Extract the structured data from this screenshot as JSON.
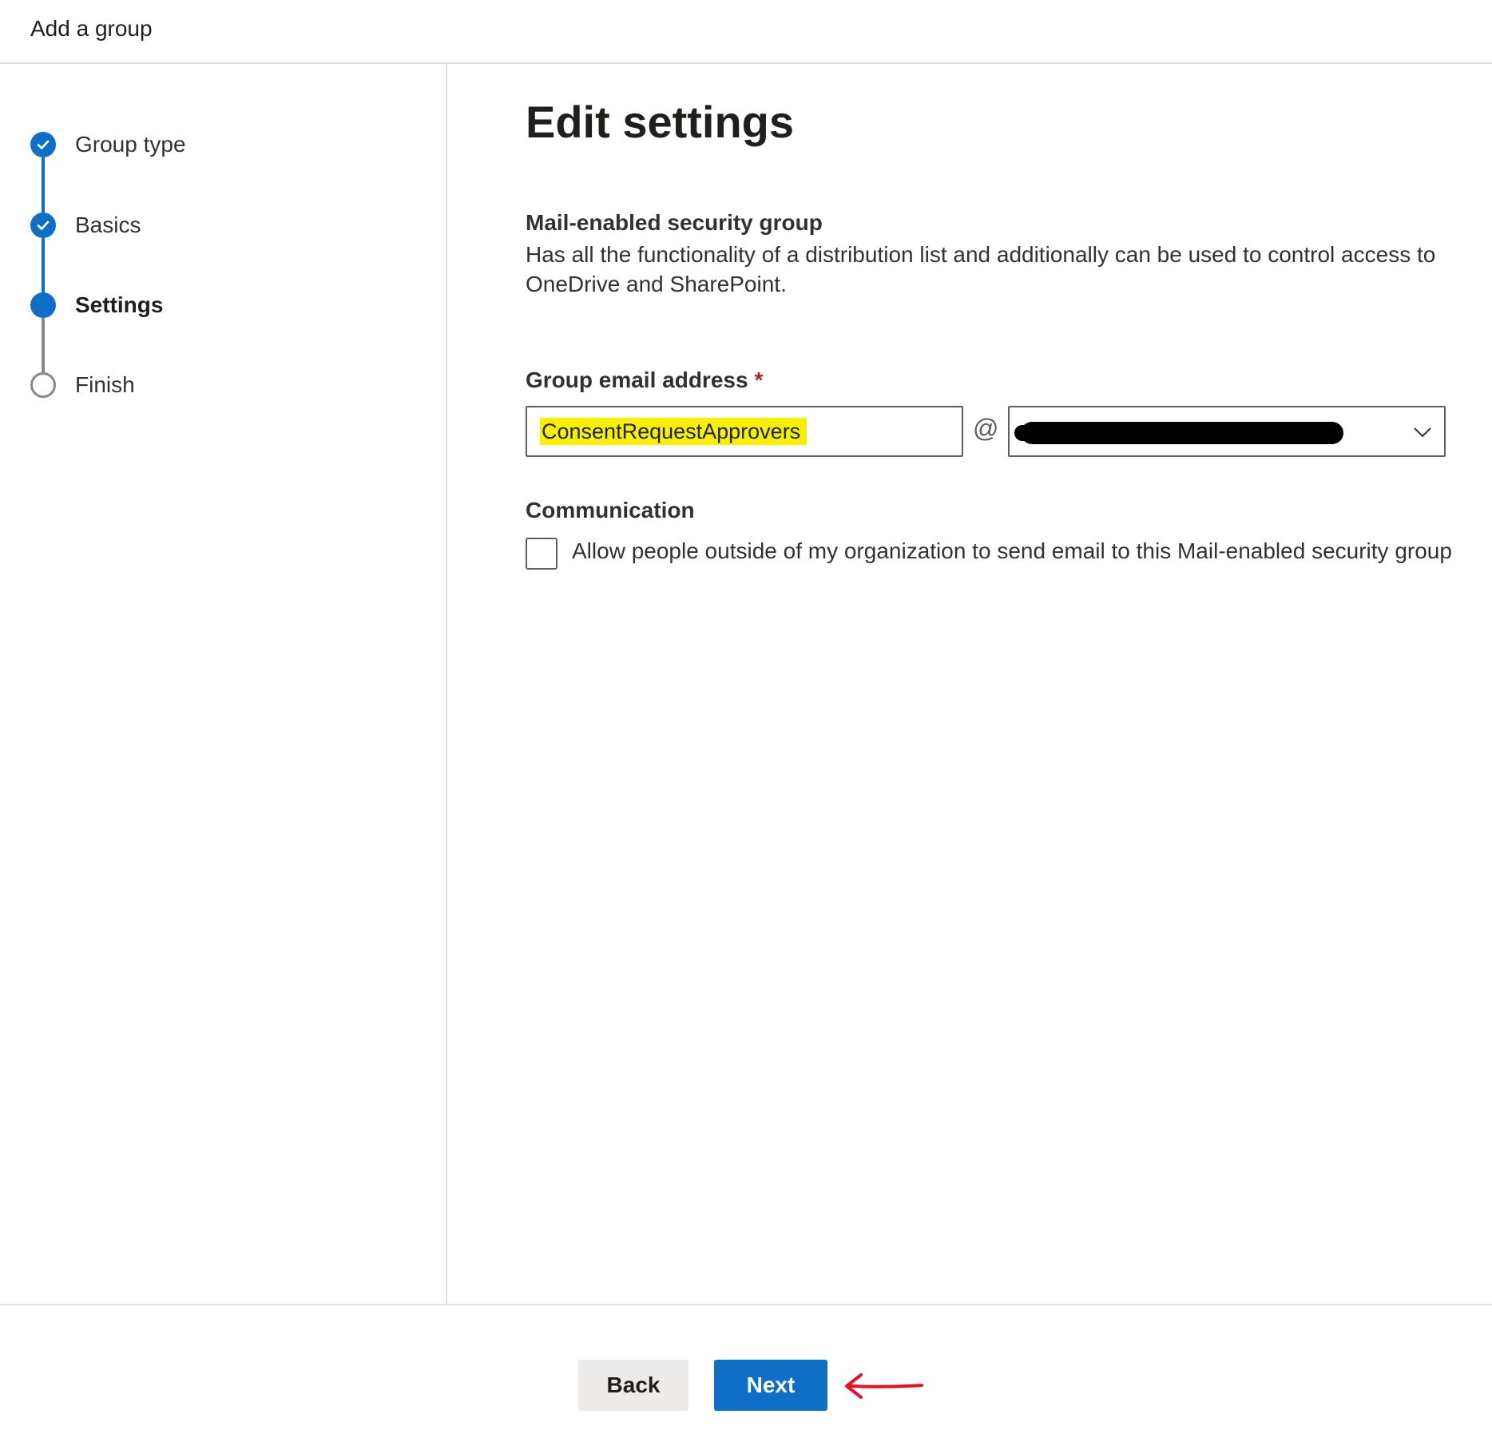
{
  "app": {
    "title": "Add a group"
  },
  "steps": [
    {
      "label": "Group type",
      "state": "done"
    },
    {
      "label": "Basics",
      "state": "done"
    },
    {
      "label": "Settings",
      "state": "current"
    },
    {
      "label": "Finish",
      "state": "todo"
    }
  ],
  "main": {
    "title": "Edit settings",
    "group_kind_title": "Mail-enabled security group",
    "group_kind_description": "Has all the functionality of a distribution list and additionally can be used to control access to OneDrive and SharePoint.",
    "email_label": "Group email address",
    "required_marker": "*",
    "email_value": "ConsentRequestApprovers",
    "at_sign": "@",
    "domain_value": "",
    "communication_title": "Communication",
    "allow_external_label": "Allow people outside of my organization to send email to this Mail-enabled security group",
    "allow_external_checked": false
  },
  "footer": {
    "back_label": "Back",
    "next_label": "Next"
  },
  "colors": {
    "accent": "#0f6fc6",
    "highlight": "#f7f100",
    "annotation_arrow": "#e81123",
    "required": "#a4262c"
  },
  "icons": {
    "step_done": "check-icon",
    "dropdown": "chevron-down-icon",
    "annotation": "arrow-left-icon"
  }
}
